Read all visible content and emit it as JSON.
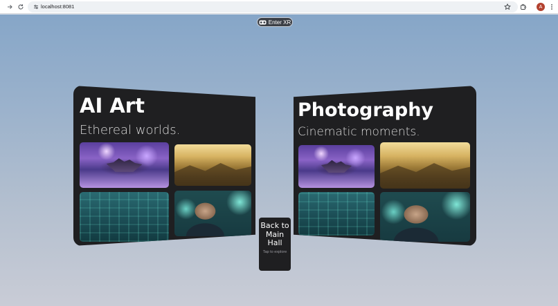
{
  "browser": {
    "url": "localhost:8081",
    "profile_initial": "A",
    "icons": {
      "forward": "forward-arrow-icon",
      "reload": "reload-icon",
      "site_info": "site-settings-icon",
      "bookmark": "star-icon",
      "extensions": "puzzle-icon",
      "menu": "kebab-menu-icon"
    },
    "avatar_color": "#b3412f"
  },
  "scene": {
    "xr_button": {
      "label": "Enter XR",
      "icon": "vr-headset-icon"
    },
    "panels": [
      {
        "title": "AI Art",
        "subtitle": "Ethereal worlds.",
        "thumbnails": [
          "floating-castle-image",
          "golden-mountains-image",
          "teal-circuit-image",
          "man-with-glasses-image"
        ]
      },
      {
        "title": "Photography",
        "subtitle": "Cinematic moments.",
        "thumbnails": [
          "floating-castle-image",
          "golden-mountains-image",
          "teal-circuit-image",
          "man-with-glasses-image"
        ]
      }
    ],
    "back_card": {
      "label": "Back to Main Hall",
      "hint": "Tap to explore"
    },
    "colors": {
      "panel_bg": "#1f1f21",
      "sky_top": "#86a6c8",
      "sky_bottom": "#c9ccd6"
    }
  }
}
